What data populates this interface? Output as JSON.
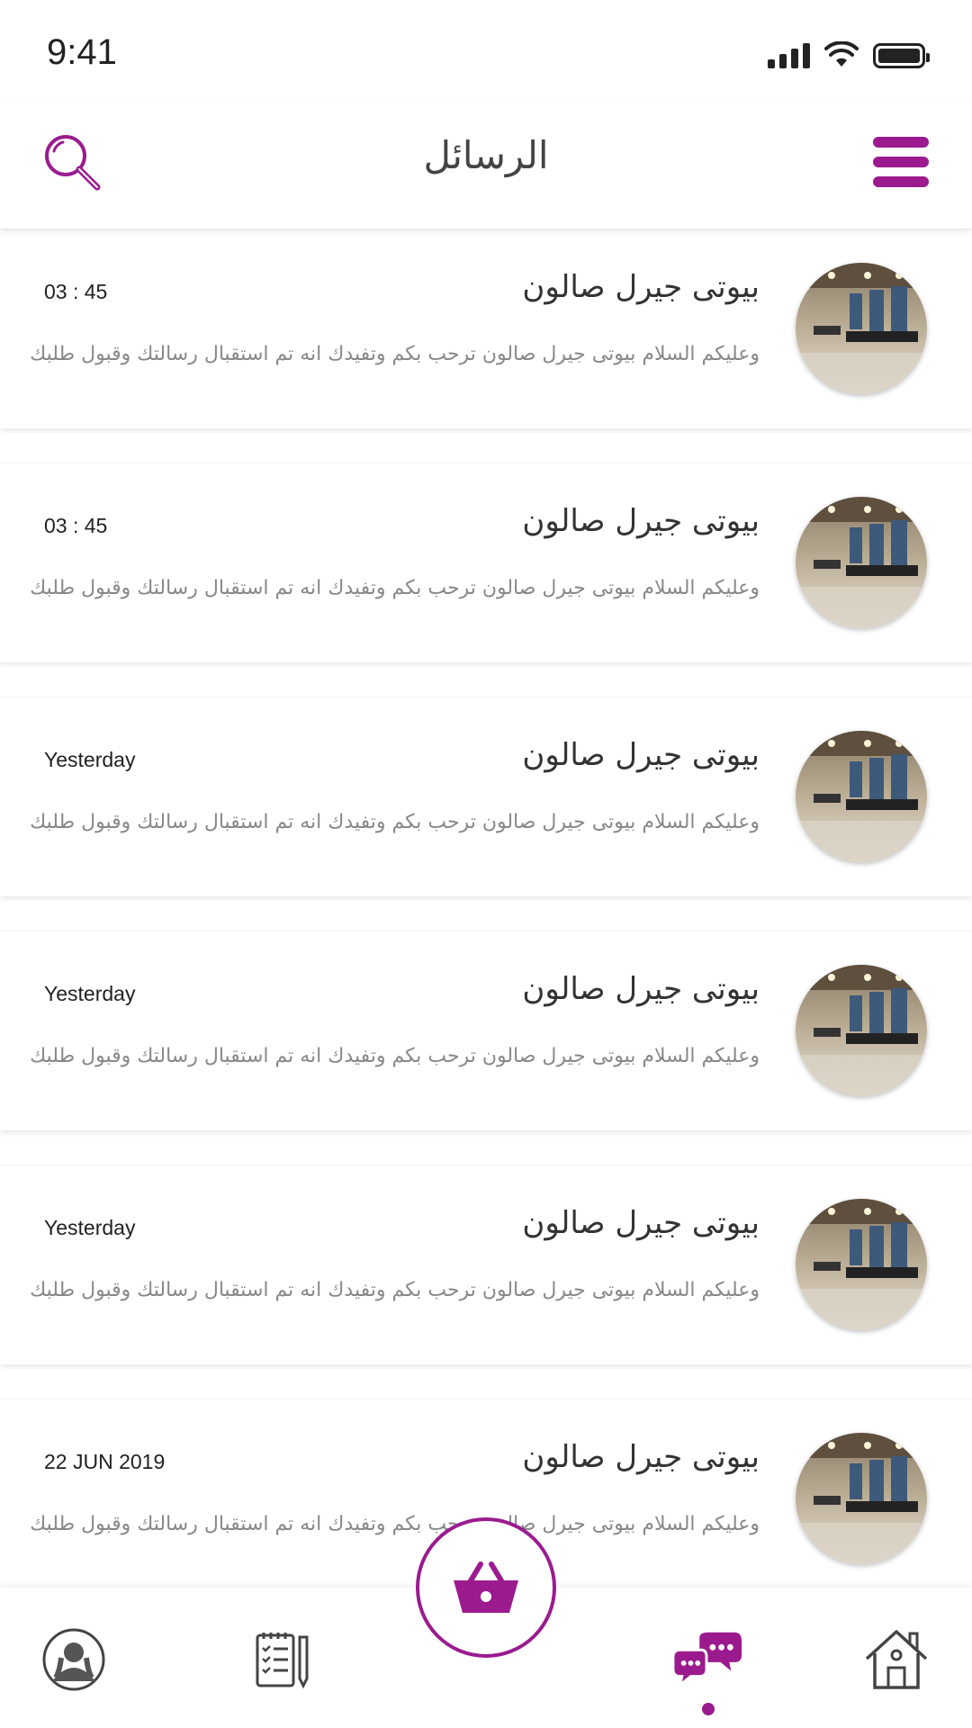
{
  "status": {
    "time": "9:41"
  },
  "header": {
    "title": "الرسائل",
    "search_icon": "search-icon",
    "menu_icon": "menu-icon"
  },
  "messages": [
    {
      "title": "بيوتى جيرل صالون",
      "time": "03 : 45",
      "body": "وعليكم السلام بيوتى جيرل صالون ترحب بكم وتفيدك انه تم استقبال رسالتك وقبول طلبك"
    },
    {
      "title": "بيوتى جيرل صالون",
      "time": "03 : 45",
      "body": "وعليكم السلام بيوتى جيرل صالون ترحب بكم وتفيدك انه تم استقبال رسالتك وقبول طلبك"
    },
    {
      "title": "بيوتى جيرل صالون",
      "time": "Yesterday",
      "body": "وعليكم السلام بيوتى جيرل صالون ترحب بكم وتفيدك انه تم استقبال رسالتك وقبول طلبك"
    },
    {
      "title": "بيوتى جيرل صالون",
      "time": "Yesterday",
      "body": "وعليكم السلام بيوتى جيرل صالون ترحب بكم وتفيدك انه تم استقبال رسالتك وقبول طلبك"
    },
    {
      "title": "بيوتى جيرل صالون",
      "time": "Yesterday",
      "body": "وعليكم السلام بيوتى جيرل صالون ترحب بكم وتفيدك انه تم استقبال رسالتك وقبول طلبك"
    },
    {
      "title": "بيوتى جيرل صالون",
      "time": "22 JUN 2019",
      "body": "وعليكم السلام بيوتى جيرل صالون ترحب بكم وتفيدك انه تم استقبال رسالتك وقبول طلبك"
    }
  ],
  "bottom_nav": {
    "items": [
      {
        "icon": "profile-icon"
      },
      {
        "icon": "orders-icon"
      },
      {
        "icon": "cart-icon"
      },
      {
        "icon": "messages-icon",
        "active": true
      },
      {
        "icon": "home-icon"
      }
    ]
  },
  "colors": {
    "accent": "#9b1b8f",
    "text": "#333333",
    "muted": "#888888"
  }
}
